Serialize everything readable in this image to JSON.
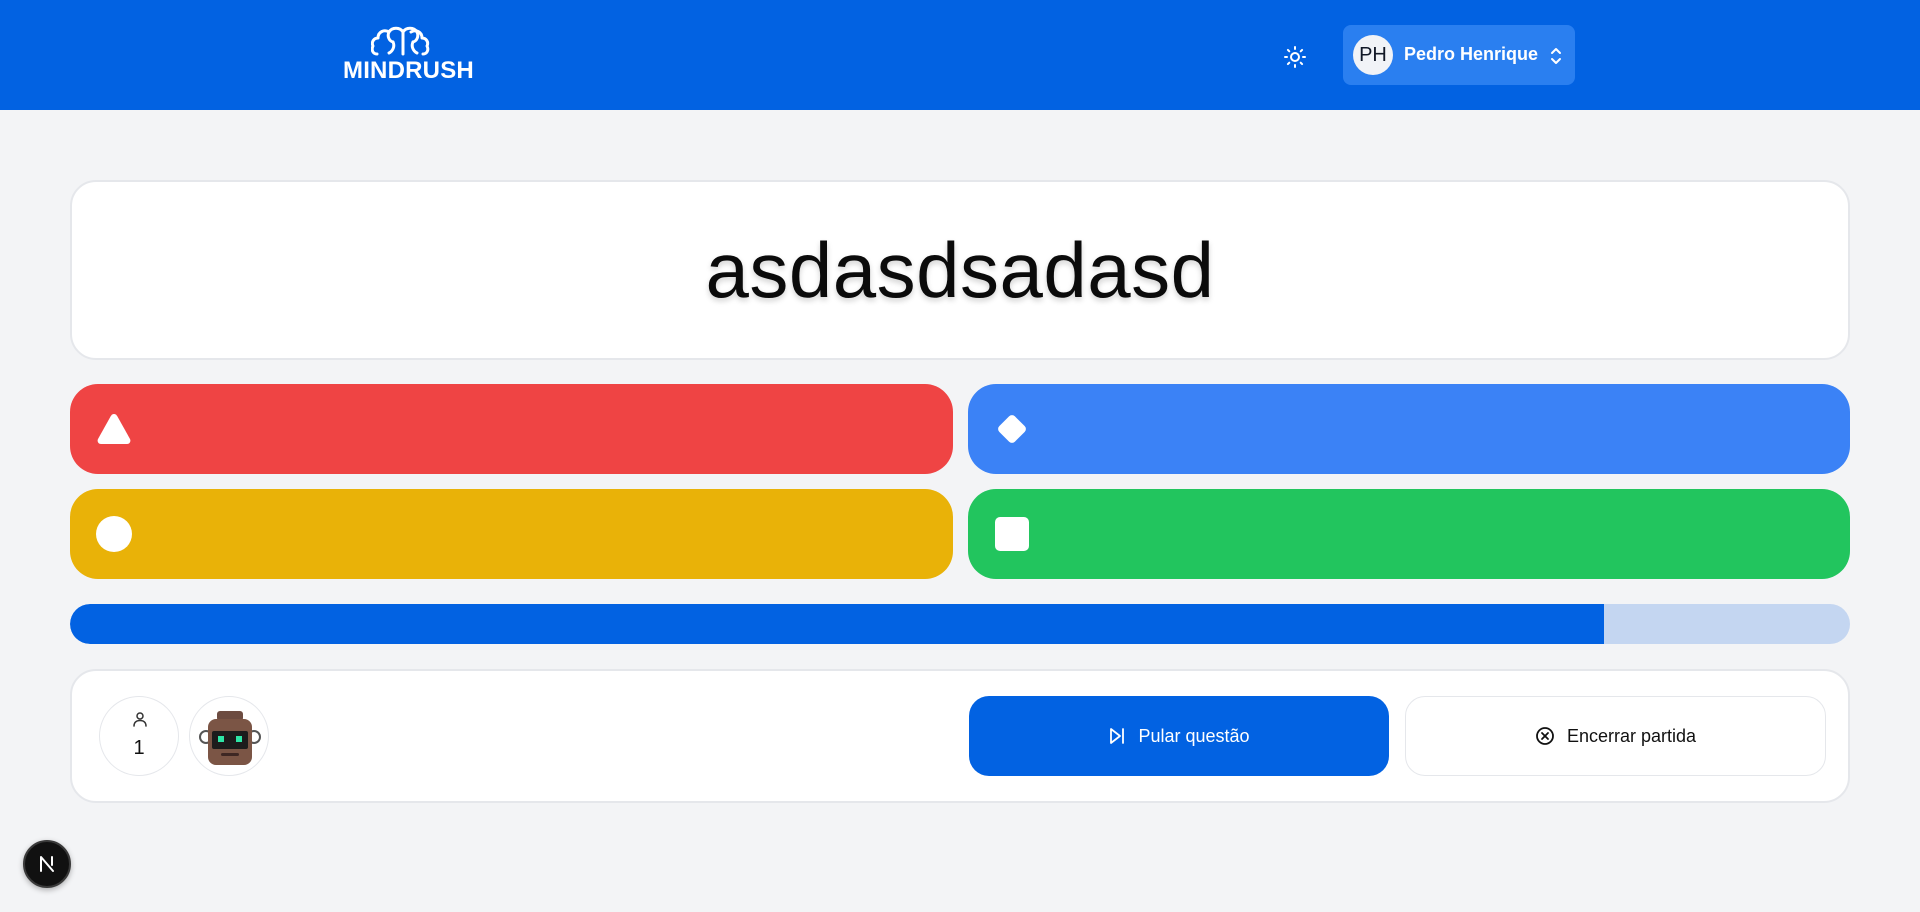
{
  "header": {
    "logo_text": "MINDRUSH",
    "user": {
      "initials": "PH",
      "name": "Pedro Henrique"
    }
  },
  "question": {
    "text": "asdasdsadasd"
  },
  "answers": [
    {
      "shape": "triangle-icon",
      "color": "#ef4444",
      "label": ""
    },
    {
      "shape": "diamond-icon",
      "color": "#3b82f6",
      "label": ""
    },
    {
      "shape": "circle-icon",
      "color": "#e9b208",
      "label": ""
    },
    {
      "shape": "square-icon",
      "color": "#22c55e",
      "label": ""
    }
  ],
  "timer": {
    "progress_percent": 86.2
  },
  "footer": {
    "player_count": "1",
    "skip_label": "Pular questão",
    "end_label": "Encerrar partida"
  },
  "next_badge": {
    "letter": "N"
  },
  "colors": {
    "brand": "#0262e2",
    "background": "#f3f4f6"
  }
}
